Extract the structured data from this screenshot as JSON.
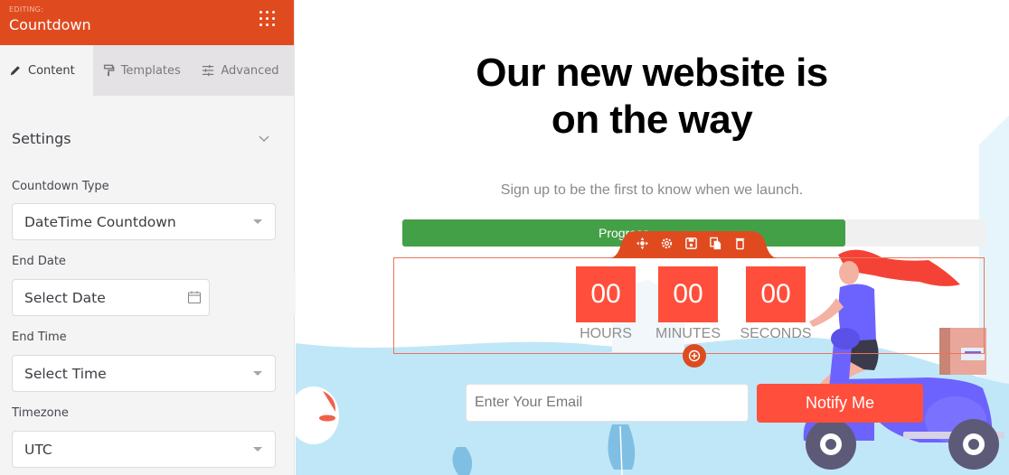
{
  "sidebar": {
    "editing_label": "EDITING:",
    "module_title": "Countdown",
    "menu_icon": "grid-dots-icon",
    "tabs": [
      {
        "label": "Content",
        "icon": "pencil-icon",
        "active": true
      },
      {
        "label": "Templates",
        "icon": "paint-roller-icon",
        "active": false
      },
      {
        "label": "Advanced",
        "icon": "sliders-icon",
        "active": false
      }
    ],
    "section_title": "Settings",
    "fields": {
      "countdown_type": {
        "label": "Countdown Type",
        "value": "DateTime Countdown"
      },
      "end_date": {
        "label": "End Date",
        "placeholder": "Select Date"
      },
      "end_time": {
        "label": "End Time",
        "value": "Select Time"
      },
      "timezone": {
        "label": "Timezone",
        "value": "UTC"
      }
    }
  },
  "page": {
    "headline_line1": "Our new website is",
    "headline_line2": "on the way",
    "subheadline": "Sign up to be the first to know when we launch.",
    "progress": {
      "label": "Progress",
      "percent": 76
    },
    "module_toolbar": [
      "move-icon",
      "settings-icon",
      "save-icon",
      "duplicate-icon",
      "delete-icon"
    ],
    "countdown": [
      {
        "value": "00",
        "label": "HOURS"
      },
      {
        "value": "00",
        "label": "MINUTES"
      },
      {
        "value": "00",
        "label": "SECONDS"
      }
    ],
    "email_placeholder": "Enter Your Email",
    "notify_label": "Notify Me"
  },
  "colors": {
    "brand": "#df4b1f",
    "countdown_box": "#ff4f3c",
    "progress_fill": "#43a047",
    "wave": "#c0e7f7"
  }
}
